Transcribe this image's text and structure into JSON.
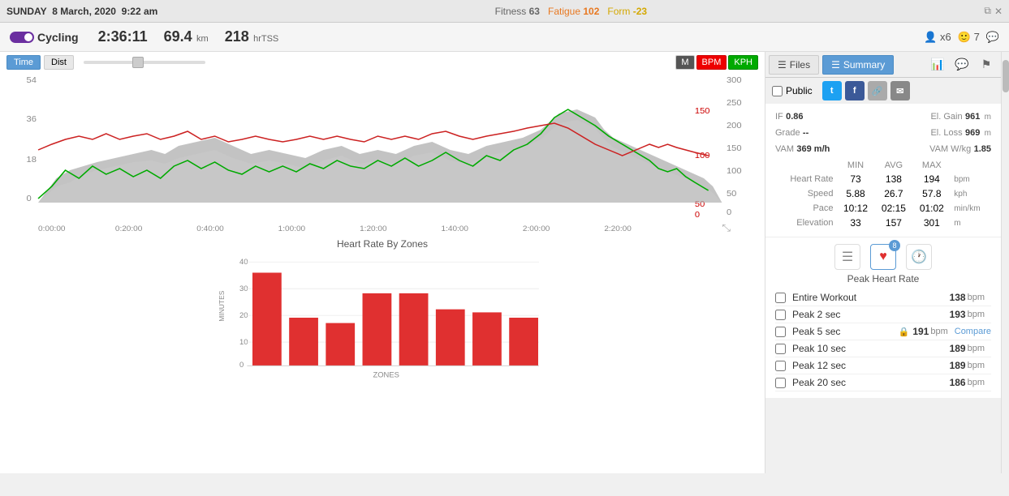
{
  "topbar": {
    "day": "SUNDAY",
    "date": "8 March, 2020",
    "time": "9:22 am",
    "fitness_label": "Fitness",
    "fitness_val": "63",
    "fatigue_label": "Fatigue",
    "fatigue_val": "102",
    "form_label": "Form",
    "form_val": "-23"
  },
  "activity": {
    "title": "Cycling",
    "duration": "2:36:11",
    "distance": "69.4",
    "distance_unit": "km",
    "tss": "218",
    "tss_label": "hrTSS",
    "athletes": "x6",
    "kudos": "7"
  },
  "tabs": {
    "files_label": "Files",
    "summary_label": "Summary"
  },
  "social": {
    "public_label": "Public"
  },
  "chart": {
    "time_label": "Time",
    "dist_label": "Dist",
    "m_label": "M",
    "bpm_label": "BPM",
    "kph_label": "KPH",
    "y_left": [
      "54",
      "36",
      "18",
      "0"
    ],
    "y_right_bpm": [
      "150",
      "100"
    ],
    "y_right_kph": [
      "300",
      "250",
      "200",
      "150",
      "100",
      "50",
      "0"
    ],
    "x_axis": [
      "0:00:00",
      "0:20:00",
      "0:40:00",
      "1:00:00",
      "1:20:00",
      "1:40:00",
      "2:00:00",
      "2:20:00"
    ]
  },
  "zones_chart": {
    "title": "Heart Rate By Zones",
    "x_label": "ZONES",
    "y_label": "MINUTES",
    "bars": [
      35,
      18,
      16,
      27,
      27,
      21,
      20,
      18
    ],
    "max_val": 40
  },
  "stats_top": {
    "if_label": "IF",
    "if_val": "0.86",
    "el_gain_label": "El. Gain",
    "el_gain_val": "961",
    "el_gain_unit": "m",
    "grade_label": "Grade",
    "grade_val": "--",
    "el_loss_label": "El. Loss",
    "el_loss_val": "969",
    "el_loss_unit": "m",
    "vam_label": "VAM",
    "vam_val": "369 m/h",
    "vam_wkg_label": "VAM W/kg",
    "vam_wkg_val": "1.85"
  },
  "stats_table": {
    "min_label": "MIN",
    "avg_label": "AVG",
    "max_label": "MAX",
    "rows": [
      {
        "label": "Heart Rate",
        "min": "73",
        "avg": "138",
        "max": "194",
        "unit": "bpm"
      },
      {
        "label": "Speed",
        "min": "5.88",
        "avg": "26.7",
        "max": "57.8",
        "unit": "kph"
      },
      {
        "label": "Pace",
        "min": "10:12",
        "avg": "02:15",
        "max": "01:02",
        "unit": "min/km"
      },
      {
        "label": "Elevation",
        "min": "33",
        "avg": "157",
        "max": "301",
        "unit": "m"
      }
    ]
  },
  "peak_hr": {
    "badge_count": "8",
    "label": "Peak Heart Rate",
    "items": [
      {
        "label": "Entire Workout",
        "val": "138",
        "unit": "bpm",
        "compare": false,
        "lock": false
      },
      {
        "label": "Peak 2 sec",
        "val": "193",
        "unit": "bpm",
        "compare": false,
        "lock": false
      },
      {
        "label": "Peak 5 sec",
        "val": "191",
        "unit": "bpm",
        "compare": true,
        "lock": true
      },
      {
        "label": "Peak 10 sec",
        "val": "189",
        "unit": "bpm",
        "compare": false,
        "lock": false
      },
      {
        "label": "Peak 12 sec",
        "val": "189",
        "unit": "bpm",
        "compare": false,
        "lock": false
      },
      {
        "label": "Peak 20 sec",
        "val": "186",
        "unit": "bpm",
        "compare": false,
        "lock": false
      }
    ],
    "compare_label": "Compare"
  }
}
